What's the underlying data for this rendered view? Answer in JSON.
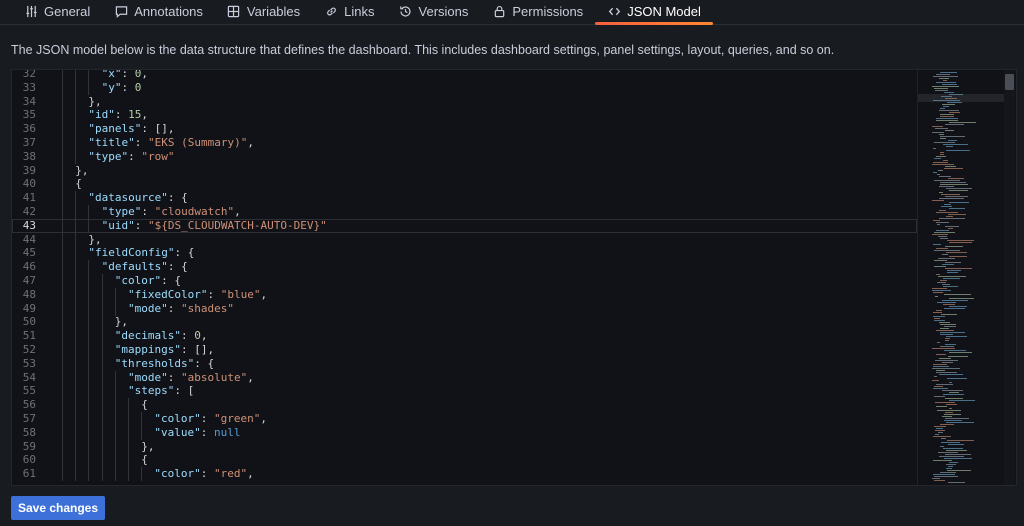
{
  "tabs": [
    {
      "label": "General",
      "icon": "sliders-icon"
    },
    {
      "label": "Annotations",
      "icon": "comment-icon"
    },
    {
      "label": "Variables",
      "icon": "calculator-icon"
    },
    {
      "label": "Links",
      "icon": "link-icon"
    },
    {
      "label": "Versions",
      "icon": "history-icon"
    },
    {
      "label": "Permissions",
      "icon": "lock-icon"
    },
    {
      "label": "JSON Model",
      "icon": "code-brackets-icon",
      "active": true
    }
  ],
  "description": "The JSON model below is the data structure that defines the dashboard. This includes dashboard settings, panel settings, layout, queries, and so on.",
  "editor": {
    "current_line": 43,
    "lines": [
      {
        "n": "32",
        "indent": 4,
        "code": "\"x\": 0,"
      },
      {
        "n": "33",
        "indent": 4,
        "code": "\"y\": 0"
      },
      {
        "n": "34",
        "indent": 3,
        "code": "},"
      },
      {
        "n": "35",
        "indent": 3,
        "code": "\"id\": 15,"
      },
      {
        "n": "36",
        "indent": 3,
        "code": "\"panels\": [],"
      },
      {
        "n": "37",
        "indent": 3,
        "code": "\"title\": \"EKS (Summary)\","
      },
      {
        "n": "38",
        "indent": 3,
        "code": "\"type\": \"row\""
      },
      {
        "n": "39",
        "indent": 2,
        "code": "},"
      },
      {
        "n": "40",
        "indent": 2,
        "code": "{"
      },
      {
        "n": "41",
        "indent": 3,
        "code": "\"datasource\": {"
      },
      {
        "n": "42",
        "indent": 4,
        "code": "\"type\": \"cloudwatch\","
      },
      {
        "n": "43",
        "indent": 4,
        "code": "\"uid\": \"${DS_CLOUDWATCH-AUTO-DEV}\""
      },
      {
        "n": "44",
        "indent": 3,
        "code": "},"
      },
      {
        "n": "45",
        "indent": 3,
        "code": "\"fieldConfig\": {"
      },
      {
        "n": "46",
        "indent": 4,
        "code": "\"defaults\": {"
      },
      {
        "n": "47",
        "indent": 5,
        "code": "\"color\": {"
      },
      {
        "n": "48",
        "indent": 6,
        "code": "\"fixedColor\": \"blue\","
      },
      {
        "n": "49",
        "indent": 6,
        "code": "\"mode\": \"shades\""
      },
      {
        "n": "50",
        "indent": 5,
        "code": "},"
      },
      {
        "n": "51",
        "indent": 5,
        "code": "\"decimals\": 0,"
      },
      {
        "n": "52",
        "indent": 5,
        "code": "\"mappings\": [],"
      },
      {
        "n": "53",
        "indent": 5,
        "code": "\"thresholds\": {"
      },
      {
        "n": "54",
        "indent": 6,
        "code": "\"mode\": \"absolute\","
      },
      {
        "n": "55",
        "indent": 6,
        "code": "\"steps\": ["
      },
      {
        "n": "56",
        "indent": 7,
        "code": "{"
      },
      {
        "n": "57",
        "indent": 8,
        "code": "\"color\": \"green\","
      },
      {
        "n": "58",
        "indent": 8,
        "code": "\"value\": null"
      },
      {
        "n": "59",
        "indent": 7,
        "code": "},"
      },
      {
        "n": "60",
        "indent": 7,
        "code": "{"
      },
      {
        "n": "61",
        "indent": 8,
        "code": "\"color\": \"red\","
      }
    ]
  },
  "save_button": {
    "label": "Save changes"
  },
  "colors": {
    "accent": "#3d71d9",
    "active_tab_underline": "#f55f3e",
    "json_key": "#9cdcfe",
    "json_string": "#ce9178",
    "json_number": "#b5cea8",
    "json_literal": "#569cd6"
  }
}
